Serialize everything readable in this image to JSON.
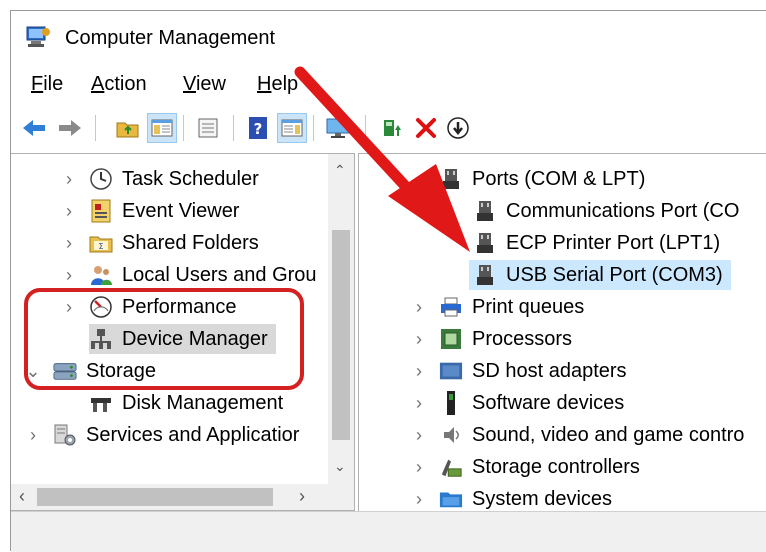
{
  "window": {
    "title": "Computer Management"
  },
  "menu": [
    {
      "label": "File",
      "u": "F",
      "rest": "ile"
    },
    {
      "label": "Action",
      "u": "A",
      "rest": "ction"
    },
    {
      "label": "View",
      "u": "V",
      "rest": "iew"
    },
    {
      "label": "Help",
      "u": "H",
      "rest": "elp"
    }
  ],
  "toolbar": [
    "back-arrow-icon",
    "forward-arrow-icon",
    "up-folder-icon",
    "show-hide-tree-icon",
    "properties-icon",
    "help-icon",
    "action-pane-icon",
    "monitor-icon",
    "update-driver-icon",
    "uninstall-device-icon",
    "disable-device-icon"
  ],
  "left_tree": [
    {
      "label": "Task Scheduler",
      "icon": "clock-icon"
    },
    {
      "label": "Event Viewer",
      "icon": "event-viewer-icon"
    },
    {
      "label": "Shared Folders",
      "icon": "shared-folders-icon"
    },
    {
      "label": "Local Users and Grou",
      "icon": "users-icon"
    },
    {
      "label": "Performance",
      "icon": "performance-icon"
    },
    {
      "label": "Device Manager",
      "icon": "device-manager-icon",
      "selected": true
    },
    {
      "label": "Storage",
      "icon": "storage-icon"
    },
    {
      "label": "Disk Management",
      "icon": "disk-management-icon"
    },
    {
      "label": "Services and Applicatior",
      "icon": "services-icon"
    }
  ],
  "right_tree": [
    {
      "label": "Ports (COM & LPT)",
      "icon": "port-icon"
    },
    {
      "label": "Communications Port (CO",
      "icon": "port-icon"
    },
    {
      "label": "ECP Printer Port (LPT1)",
      "icon": "port-icon"
    },
    {
      "label": "USB Serial Port (COM3)",
      "icon": "port-icon",
      "selected": true
    },
    {
      "label": "Print queues",
      "icon": "printer-icon"
    },
    {
      "label": "Processors",
      "icon": "processor-icon"
    },
    {
      "label": "SD host adapters",
      "icon": "sd-adapter-icon"
    },
    {
      "label": "Software devices",
      "icon": "software-device-icon"
    },
    {
      "label": "Sound, video and game contro",
      "icon": "sound-icon"
    },
    {
      "label": "Storage controllers",
      "icon": "storage-controller-icon"
    },
    {
      "label": "System devices",
      "icon": "system-devices-icon"
    }
  ],
  "colors": {
    "annotation": "#d32020",
    "selection_blue": "#cce8ff",
    "selection_grey": "#d9d9d9"
  }
}
